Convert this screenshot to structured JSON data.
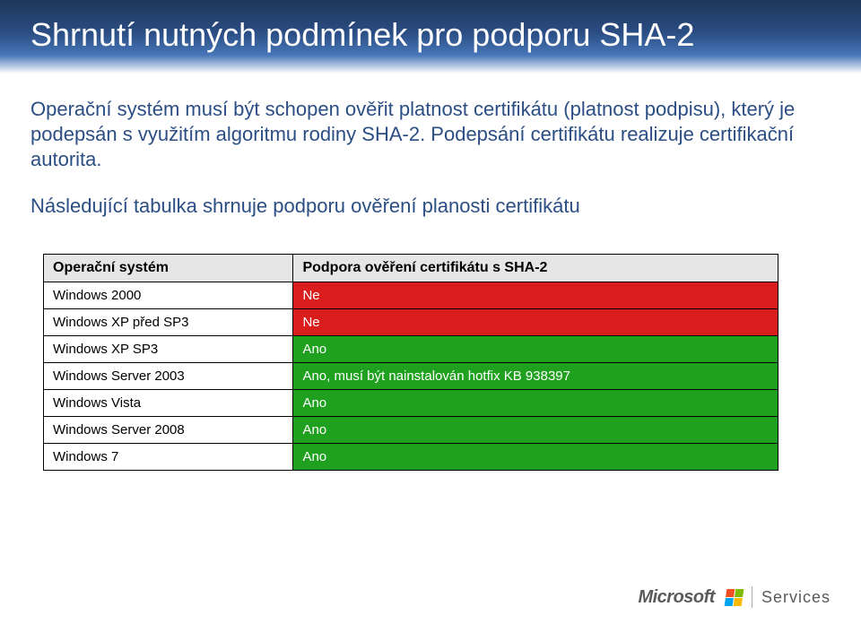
{
  "title": "Shrnutí nutných podmínek pro podporu SHA-2",
  "para1": "Operační systém musí být schopen ověřit platnost certifikátu (platnost podpisu), který je podepsán s využitím algoritmu rodiny SHA-2. Podepsání certifikátu realizuje certifikační autorita.",
  "para2": "Následující tabulka shrnuje podporu ověření planosti certifikátu",
  "table": {
    "head": {
      "os": "Operační systém",
      "support": "Podpora ověření certifikátu s SHA-2"
    },
    "rows": [
      {
        "os": "Windows 2000",
        "support": "Ne",
        "status": "red"
      },
      {
        "os": "Windows XP před SP3",
        "support": "Ne",
        "status": "red"
      },
      {
        "os": "Windows XP SP3",
        "support": "Ano",
        "status": "green"
      },
      {
        "os": "Windows Server 2003",
        "support": "Ano, musí být nainstalován hotfix KB 938397",
        "status": "green"
      },
      {
        "os": "Windows Vista",
        "support": "Ano",
        "status": "green"
      },
      {
        "os": "Windows Server 2008",
        "support": "Ano",
        "status": "green"
      },
      {
        "os": "Windows 7",
        "support": "Ano",
        "status": "green"
      }
    ]
  },
  "footer": {
    "brand": "Microsoft",
    "unit": "Services"
  }
}
